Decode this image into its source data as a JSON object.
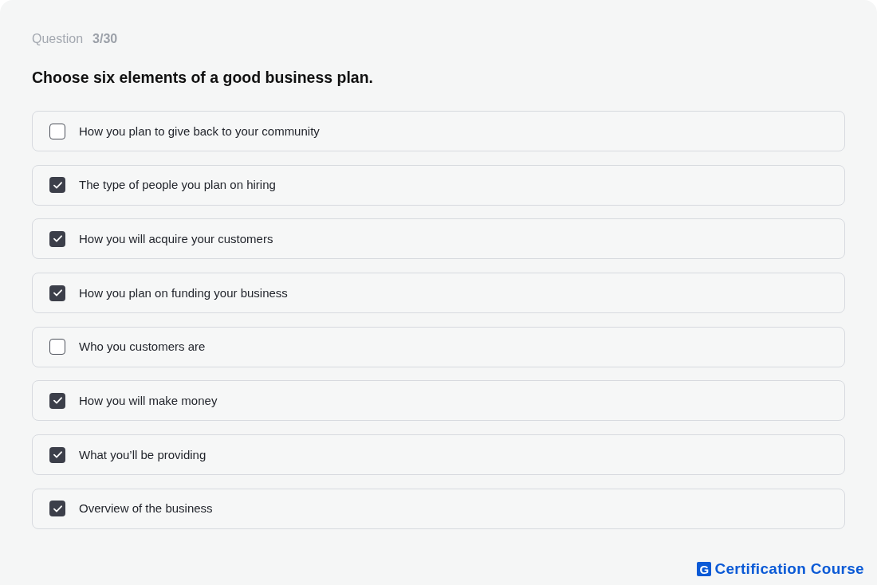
{
  "question": {
    "label": "Question",
    "number": "3/30"
  },
  "prompt": "Choose six elements of a good business plan.",
  "options": [
    {
      "text": "How you plan to give back to your community",
      "checked": false
    },
    {
      "text": "The type of people you plan on hiring",
      "checked": true
    },
    {
      "text": "How you will acquire your customers",
      "checked": true
    },
    {
      "text": "How you plan on funding your business",
      "checked": true
    },
    {
      "text": "Who you customers are",
      "checked": false
    },
    {
      "text": "How you will make money",
      "checked": true
    },
    {
      "text": "What you’ll be providing",
      "checked": true
    },
    {
      "text": "Overview of the business",
      "checked": true
    }
  ],
  "logo": {
    "mark": "G",
    "name": "Certification Course"
  }
}
